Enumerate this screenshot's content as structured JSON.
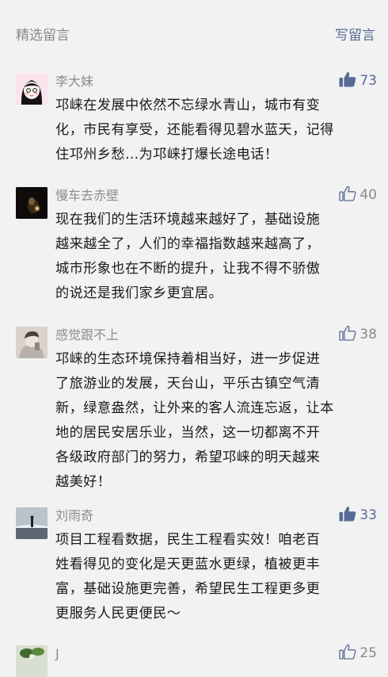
{
  "header": {
    "title": "精选留言",
    "write_label": "写留言"
  },
  "comments": [
    {
      "nickname": "李大妹",
      "likes": "73",
      "liked": true,
      "lines": [
        "邛崃在发展中依然不忘绿水青山，城市有变",
        "化，市民有享受，还能看得见碧水蓝天，记得",
        "住邛州乡愁…为邛崃打爆长途电话！"
      ]
    },
    {
      "nickname": "慢车去赤壁",
      "likes": "40",
      "liked": false,
      "lines": [
        "现在我们的生活环境越来越好了，基础设施",
        "越来越全了，人们的幸福指数越来越高了，",
        "城市形象也在不断的提升，让我不得不骄傲",
        "的说还是我们家乡更宜居。"
      ]
    },
    {
      "nickname": "感觉跟不上",
      "likes": "38",
      "liked": false,
      "lines": [
        "邛崃的生态环境保持着相当好，进一步促进",
        "了旅游业的发展，天台山，平乐古镇空气清",
        "新，绿意盎然，让外来的客人流连忘返，让本",
        "地的居民安居乐业，当然，这一切都离不开",
        "各级政府部门的努力，希望邛崃的明天越来",
        "越美好！"
      ]
    },
    {
      "nickname": "刘雨奇",
      "likes": "33",
      "liked": true,
      "lines": [
        "项目工程看数据，民生工程看实效！咱老百",
        "姓看得见的变化是天更蓝水更绿，植被更丰",
        "富，基础设施更完善，希望民生工程更多更",
        "更服务人民更便民～"
      ]
    },
    {
      "nickname": "J",
      "likes": "25",
      "liked": false,
      "lines": []
    }
  ]
}
